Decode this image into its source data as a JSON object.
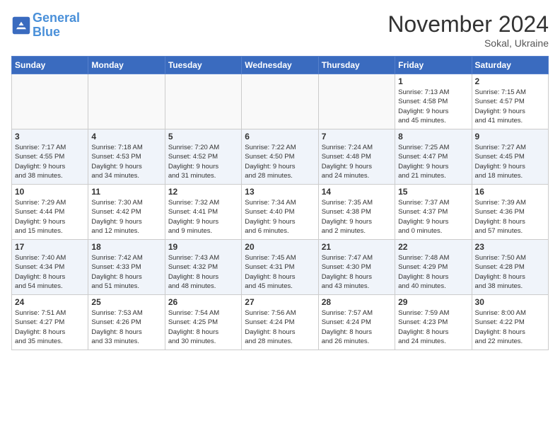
{
  "header": {
    "logo_line1": "General",
    "logo_line2": "Blue",
    "month": "November 2024",
    "location": "Sokal, Ukraine"
  },
  "weekdays": [
    "Sunday",
    "Monday",
    "Tuesday",
    "Wednesday",
    "Thursday",
    "Friday",
    "Saturday"
  ],
  "weeks": [
    [
      {
        "day": "",
        "info": ""
      },
      {
        "day": "",
        "info": ""
      },
      {
        "day": "",
        "info": ""
      },
      {
        "day": "",
        "info": ""
      },
      {
        "day": "",
        "info": ""
      },
      {
        "day": "1",
        "info": "Sunrise: 7:13 AM\nSunset: 4:58 PM\nDaylight: 9 hours\nand 45 minutes."
      },
      {
        "day": "2",
        "info": "Sunrise: 7:15 AM\nSunset: 4:57 PM\nDaylight: 9 hours\nand 41 minutes."
      }
    ],
    [
      {
        "day": "3",
        "info": "Sunrise: 7:17 AM\nSunset: 4:55 PM\nDaylight: 9 hours\nand 38 minutes."
      },
      {
        "day": "4",
        "info": "Sunrise: 7:18 AM\nSunset: 4:53 PM\nDaylight: 9 hours\nand 34 minutes."
      },
      {
        "day": "5",
        "info": "Sunrise: 7:20 AM\nSunset: 4:52 PM\nDaylight: 9 hours\nand 31 minutes."
      },
      {
        "day": "6",
        "info": "Sunrise: 7:22 AM\nSunset: 4:50 PM\nDaylight: 9 hours\nand 28 minutes."
      },
      {
        "day": "7",
        "info": "Sunrise: 7:24 AM\nSunset: 4:48 PM\nDaylight: 9 hours\nand 24 minutes."
      },
      {
        "day": "8",
        "info": "Sunrise: 7:25 AM\nSunset: 4:47 PM\nDaylight: 9 hours\nand 21 minutes."
      },
      {
        "day": "9",
        "info": "Sunrise: 7:27 AM\nSunset: 4:45 PM\nDaylight: 9 hours\nand 18 minutes."
      }
    ],
    [
      {
        "day": "10",
        "info": "Sunrise: 7:29 AM\nSunset: 4:44 PM\nDaylight: 9 hours\nand 15 minutes."
      },
      {
        "day": "11",
        "info": "Sunrise: 7:30 AM\nSunset: 4:42 PM\nDaylight: 9 hours\nand 12 minutes."
      },
      {
        "day": "12",
        "info": "Sunrise: 7:32 AM\nSunset: 4:41 PM\nDaylight: 9 hours\nand 9 minutes."
      },
      {
        "day": "13",
        "info": "Sunrise: 7:34 AM\nSunset: 4:40 PM\nDaylight: 9 hours\nand 6 minutes."
      },
      {
        "day": "14",
        "info": "Sunrise: 7:35 AM\nSunset: 4:38 PM\nDaylight: 9 hours\nand 2 minutes."
      },
      {
        "day": "15",
        "info": "Sunrise: 7:37 AM\nSunset: 4:37 PM\nDaylight: 9 hours\nand 0 minutes."
      },
      {
        "day": "16",
        "info": "Sunrise: 7:39 AM\nSunset: 4:36 PM\nDaylight: 8 hours\nand 57 minutes."
      }
    ],
    [
      {
        "day": "17",
        "info": "Sunrise: 7:40 AM\nSunset: 4:34 PM\nDaylight: 8 hours\nand 54 minutes."
      },
      {
        "day": "18",
        "info": "Sunrise: 7:42 AM\nSunset: 4:33 PM\nDaylight: 8 hours\nand 51 minutes."
      },
      {
        "day": "19",
        "info": "Sunrise: 7:43 AM\nSunset: 4:32 PM\nDaylight: 8 hours\nand 48 minutes."
      },
      {
        "day": "20",
        "info": "Sunrise: 7:45 AM\nSunset: 4:31 PM\nDaylight: 8 hours\nand 45 minutes."
      },
      {
        "day": "21",
        "info": "Sunrise: 7:47 AM\nSunset: 4:30 PM\nDaylight: 8 hours\nand 43 minutes."
      },
      {
        "day": "22",
        "info": "Sunrise: 7:48 AM\nSunset: 4:29 PM\nDaylight: 8 hours\nand 40 minutes."
      },
      {
        "day": "23",
        "info": "Sunrise: 7:50 AM\nSunset: 4:28 PM\nDaylight: 8 hours\nand 38 minutes."
      }
    ],
    [
      {
        "day": "24",
        "info": "Sunrise: 7:51 AM\nSunset: 4:27 PM\nDaylight: 8 hours\nand 35 minutes."
      },
      {
        "day": "25",
        "info": "Sunrise: 7:53 AM\nSunset: 4:26 PM\nDaylight: 8 hours\nand 33 minutes."
      },
      {
        "day": "26",
        "info": "Sunrise: 7:54 AM\nSunset: 4:25 PM\nDaylight: 8 hours\nand 30 minutes."
      },
      {
        "day": "27",
        "info": "Sunrise: 7:56 AM\nSunset: 4:24 PM\nDaylight: 8 hours\nand 28 minutes."
      },
      {
        "day": "28",
        "info": "Sunrise: 7:57 AM\nSunset: 4:24 PM\nDaylight: 8 hours\nand 26 minutes."
      },
      {
        "day": "29",
        "info": "Sunrise: 7:59 AM\nSunset: 4:23 PM\nDaylight: 8 hours\nand 24 minutes."
      },
      {
        "day": "30",
        "info": "Sunrise: 8:00 AM\nSunset: 4:22 PM\nDaylight: 8 hours\nand 22 minutes."
      }
    ]
  ]
}
